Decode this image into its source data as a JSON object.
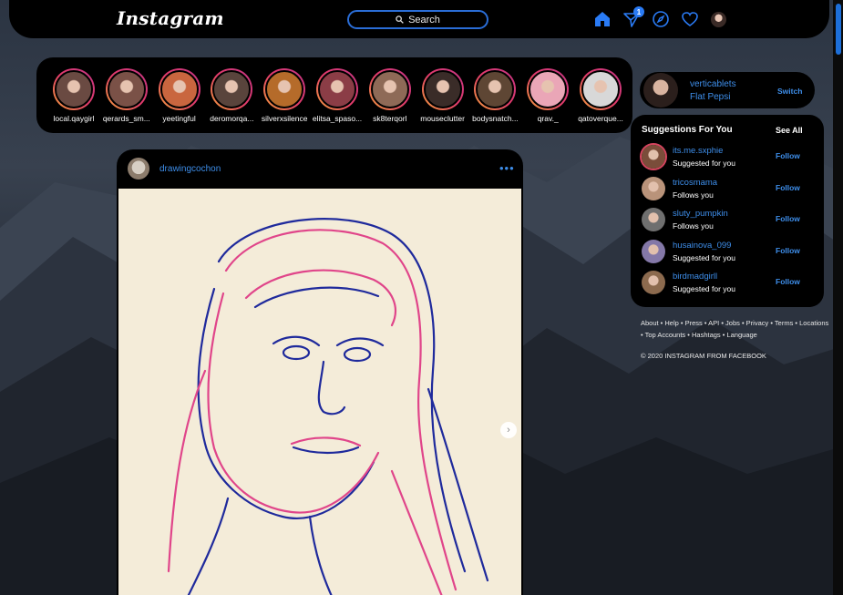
{
  "app": {
    "logo_text": "Instagram"
  },
  "nav": {
    "search_label": "Search",
    "icons": [
      "home-icon",
      "direct-message-icon",
      "explore-compass-icon",
      "activity-heart-icon",
      "profile-avatar"
    ],
    "message_badge": "1",
    "accent_color": "#2a7bf5"
  },
  "stories": [
    {
      "username": "local.qaygirl",
      "color": "#6a4a42"
    },
    {
      "username": "qerards_sm...",
      "color": "#7a5147"
    },
    {
      "username": "yeetingful",
      "color": "#c9663f"
    },
    {
      "username": "deromorqa...",
      "color": "#59443c"
    },
    {
      "username": "silverxsilence",
      "color": "#b56b2a"
    },
    {
      "username": "elitsa_spaso...",
      "color": "#8b3d46"
    },
    {
      "username": "sk8terqorl",
      "color": "#8e6a57"
    },
    {
      "username": "mouseclutter",
      "color": "#3a2c28"
    },
    {
      "username": "bodysnatch...",
      "color": "#5e4634"
    },
    {
      "username": "qrav._",
      "color": "#eaa6b7"
    },
    {
      "username": "qatoverque...",
      "color": "#d8d8d8"
    }
  ],
  "post": {
    "username": "drawingcochon",
    "more_label": "•••",
    "next_label": "›"
  },
  "profile": {
    "username": "verticablets",
    "full_name": "Flat Pepsi",
    "switch_label": "Switch"
  },
  "suggestions": {
    "title": "Suggestions For You",
    "see_all_label": "See All",
    "follow_label": "Follow",
    "items": [
      {
        "username": "its.me.sxphie",
        "reason": "Suggested for you",
        "color": "#7a4d3a"
      },
      {
        "username": "tricosmama",
        "reason": "Follows you",
        "color": "#b9937a"
      },
      {
        "username": "sluty_pumpkin",
        "reason": "Follows you",
        "color": "#6f6f6f"
      },
      {
        "username": "husainova_099",
        "reason": "Suggested for you",
        "color": "#8478a8"
      },
      {
        "username": "birdmadgirll",
        "reason": "Suggested for you",
        "color": "#8c6a4e"
      }
    ]
  },
  "footer": {
    "links": "About • Help • Press • API • Jobs • Privacy • Terms • Locations • Top Accounts • Hashtags • Language",
    "copyright": "© 2020 INSTAGRAM FROM FACEBOOK"
  }
}
